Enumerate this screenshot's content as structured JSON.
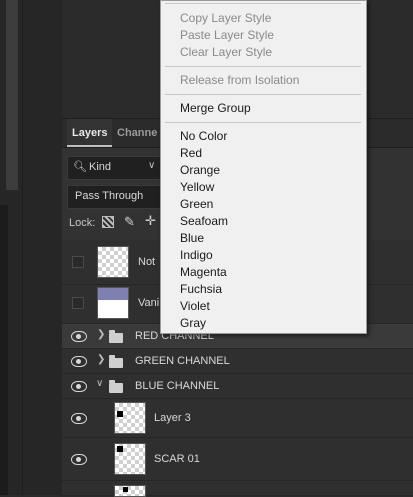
{
  "tabs": {
    "layers": "Layers",
    "channels": "Channe"
  },
  "filter": {
    "kind": "Kind",
    "blend_mode": "Pass Through",
    "lock_label": "Lock:"
  },
  "layers": [
    {
      "name": "Not",
      "visible": false
    },
    {
      "name": "Vani",
      "visible": false
    },
    {
      "name": "RED CHANNEL",
      "visible": true,
      "type": "group",
      "expanded": false
    },
    {
      "name": "GREEN CHANNEL",
      "visible": true,
      "type": "group",
      "expanded": false
    },
    {
      "name": "BLUE CHANNEL",
      "visible": true,
      "type": "group",
      "expanded": true
    },
    {
      "name": "Layer 3",
      "visible": true
    },
    {
      "name": "SCAR 01",
      "visible": true
    }
  ],
  "context_menu": {
    "style_items": [
      "Copy Layer Style",
      "Paste Layer Style",
      "Clear Layer Style"
    ],
    "isolation_item": "Release from Isolation",
    "merge_item": "Merge Group",
    "colors": [
      "No Color",
      "Red",
      "Orange",
      "Yellow",
      "Green",
      "Seafoam",
      "Blue",
      "Indigo",
      "Magenta",
      "Fuchsia",
      "Violet",
      "Gray"
    ]
  },
  "theme": {
    "panel_bg": "#2b2b2b",
    "menu_bg": "#f0f0f0",
    "vani_thumb_color": "#8080b0"
  }
}
